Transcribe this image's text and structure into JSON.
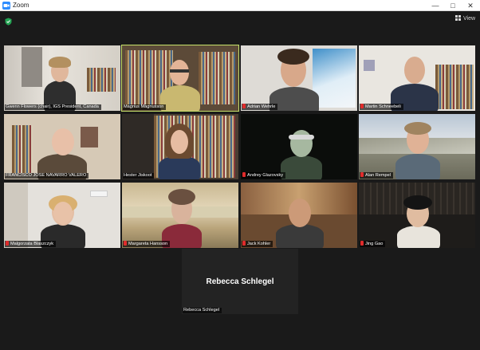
{
  "window": {
    "title": "Zoom",
    "minimize": "—",
    "maximize": "□",
    "close": "✕"
  },
  "toolbar": {
    "view_label": "View",
    "security_icon": "shield-icon",
    "view_icon": "grid-icon"
  },
  "participants": [
    {
      "name": "Gwenn Flowers (chair), IGS President, Canada",
      "muted": false
    },
    {
      "name": "Magnus Magnusson",
      "muted": false,
      "active_speaker": true
    },
    {
      "name": "Adrian Wehrle",
      "muted": true
    },
    {
      "name": "Martin Schneebeli",
      "muted": true
    },
    {
      "name": "FRANCISCO JOSE NAVARRO VALERO",
      "muted": true
    },
    {
      "name": "Hester Jiskoot",
      "muted": false
    },
    {
      "name": "Andrey Glazovsky",
      "muted": true
    },
    {
      "name": "Alan Rempel",
      "muted": true
    },
    {
      "name": "Malgorzata Blaszczyk",
      "muted": true
    },
    {
      "name": "Margareta Hansson",
      "muted": true
    },
    {
      "name": "Jack Kohler",
      "muted": true
    },
    {
      "name": "Jing Gao",
      "muted": true
    }
  ],
  "no_video_tile": {
    "display_name": "Rebecca Schlegel",
    "name_label": "Rebecca Schlegel"
  },
  "colors": {
    "background": "#1a1a1a",
    "active_speaker_border": "#c6e06a",
    "muted_icon": "#e02b2b",
    "security_green": "#23a352",
    "zoom_blue": "#2d8cff"
  }
}
